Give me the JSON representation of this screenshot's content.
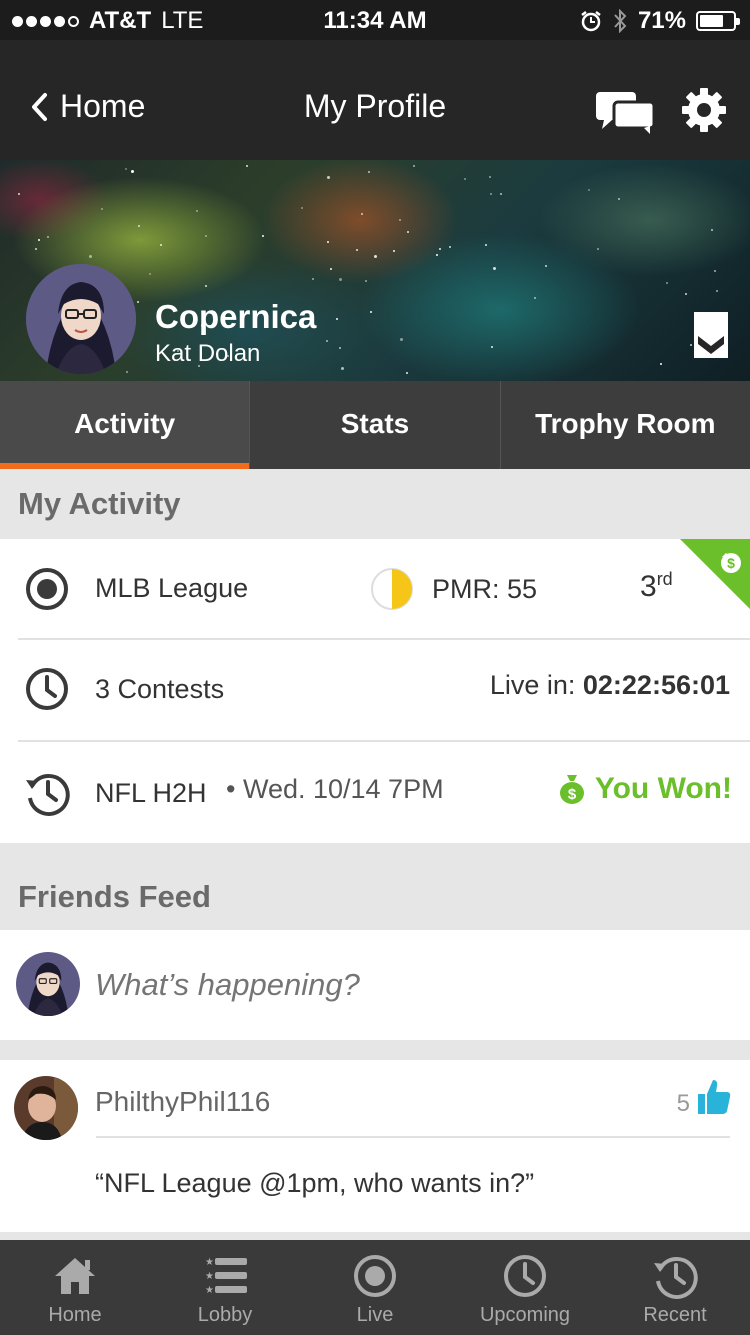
{
  "status_bar": {
    "carrier": "AT&T",
    "network": "LTE",
    "time": "11:34 AM",
    "battery": "71%",
    "battery_level": 0.71
  },
  "nav": {
    "back_label": "Home",
    "title": "My Profile"
  },
  "profile": {
    "username": "Copernica",
    "real_name": "Kat Dolan"
  },
  "tabs": [
    {
      "label": "Activity",
      "active": true
    },
    {
      "label": "Stats",
      "active": false
    },
    {
      "label": "Trophy Room",
      "active": false
    }
  ],
  "activity": {
    "header": "My Activity",
    "mlb": {
      "label": "MLB League",
      "pmr_label": "PMR: 55",
      "pmr_fraction": 0.5,
      "rank": "3",
      "rank_suffix": "rd"
    },
    "contests": {
      "label": "3 Contests",
      "live_prefix": "Live in:",
      "countdown": "02:22:56:01"
    },
    "nfl": {
      "label": "NFL H2H",
      "date": "• Wed. 10/14 7PM",
      "result": "You Won!"
    }
  },
  "feed": {
    "header": "Friends Feed",
    "composer_placeholder": "What’s happening?",
    "posts": [
      {
        "user": "PhilthyPhil116",
        "likes": "5",
        "text": "“NFL League @1pm, who wants in?”"
      }
    ]
  },
  "tabbar": [
    {
      "label": "Home",
      "icon": "home-icon"
    },
    {
      "label": "Lobby",
      "icon": "list-icon"
    },
    {
      "label": "Live",
      "icon": "live-icon"
    },
    {
      "label": "Upcoming",
      "icon": "clock-icon"
    },
    {
      "label": "Recent",
      "icon": "history-icon"
    }
  ],
  "colors": {
    "accent_orange": "#f36c1c",
    "win_green": "#6abf2a",
    "like_blue": "#2ab3d9",
    "pmr_yellow": "#f5c518"
  }
}
